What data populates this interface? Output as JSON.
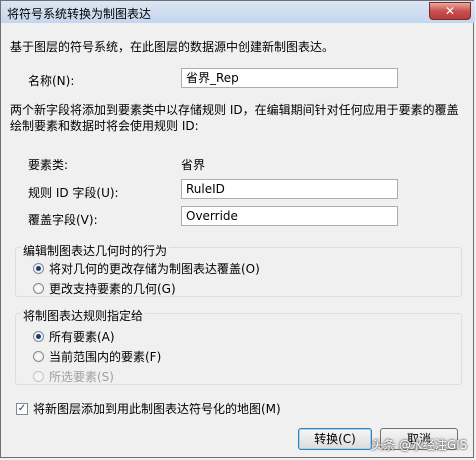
{
  "window": {
    "title": "将符号系统转换为制图表达",
    "close_label": "✕"
  },
  "intro": "基于图层的符号系统，在此图层的数据源中创建新制图表达。",
  "name_field": {
    "label": "名称(N):",
    "value": "省界_Rep"
  },
  "description": "两个新字段将添加到要素类中以存储规则 ID，在编辑期间针对任何应用于要素的覆盖绘制要素和数据时将会使用规则 ID:",
  "feature_class": {
    "label": "要素类:",
    "value": "省界"
  },
  "rule_id_field": {
    "label": "规则 ID 字段(U):",
    "value": "RuleID"
  },
  "override_field": {
    "label": "覆盖字段(V):",
    "value": "Override"
  },
  "geometry_group": {
    "title": "编辑制图表达几何时的行为",
    "options": [
      {
        "label": "将对几何的更改存储为制图表达覆盖(O)",
        "checked": true
      },
      {
        "label": "更改支持要素的几何(G)",
        "checked": false
      }
    ]
  },
  "assign_group": {
    "title": "将制图表达规则指定给",
    "options": [
      {
        "label": "所有要素(A)",
        "checked": true,
        "enabled": true
      },
      {
        "label": "当前范围内的要素(F)",
        "checked": false,
        "enabled": true
      },
      {
        "label": "所选要素(S)",
        "checked": false,
        "enabled": false
      }
    ]
  },
  "add_layer_checkbox": {
    "label": "将新图层添加到用此制图表达符号化的地图(M)",
    "checked": true
  },
  "buttons": {
    "convert": "转换(C)",
    "cancel": "取消"
  },
  "watermark": "头条 @水经注GIS"
}
